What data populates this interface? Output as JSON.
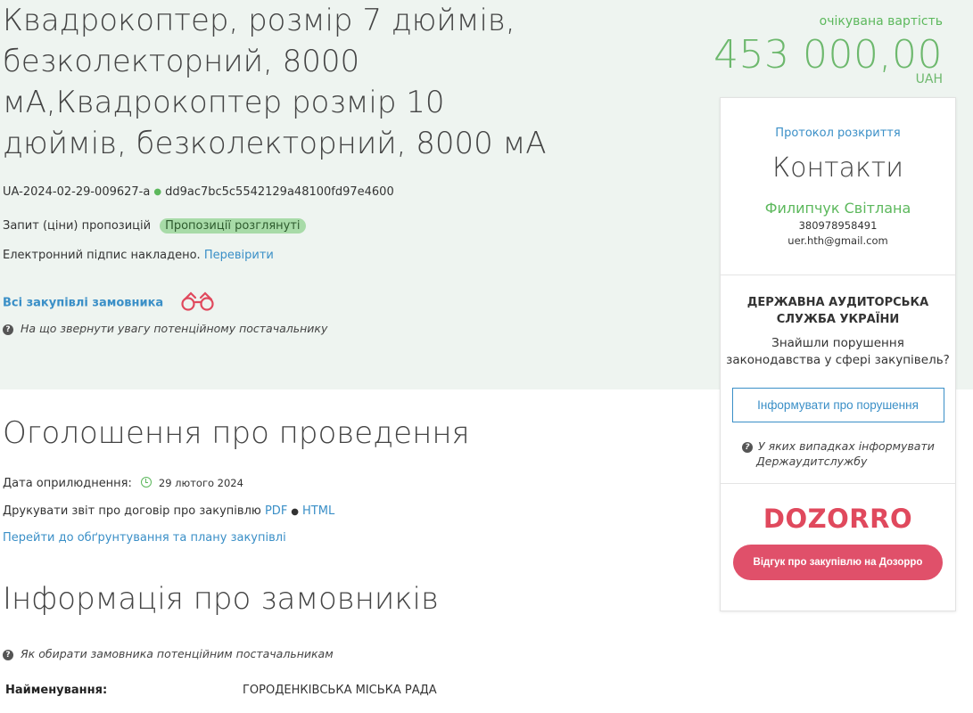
{
  "tender": {
    "title": "Квадрокоптер, розмір 7 дюймів, безколекторний, 8000 мА,Квадрокоптер розмір 10 дюймів, безколекторний, 8000 мА",
    "id": "UA-2024-02-29-009627-a",
    "hash": "dd9ac7bc5c5542129a48100fd97e4600",
    "procedure_type": "Запит (ціни) пропозицій",
    "status_badge": "Пропозиції розглянуті",
    "signature_text": "Електронний підпис накладено.",
    "signature_link": "Перевірити",
    "all_purchases_link": "Всі закупівлі замовника",
    "supplier_note": "На що звернути увагу потенційному постачальнику"
  },
  "price": {
    "label": "очікувана вартість",
    "value": "453 000,00",
    "currency": "UAH"
  },
  "sidebar": {
    "protocol_link": "Протокол розкриття",
    "contacts_heading": "Контакти",
    "contact_name": "Филипчук Світлана",
    "contact_phone": "380978958491",
    "contact_email": "uer.hth@gmail.com",
    "das_title": "ДЕРЖАВНА АУДИТОРСЬКА СЛУЖБА УКРАЇНИ",
    "das_text": "Знайшли порушення законодавства у сфері закупівель?",
    "das_button": "Інформувати про порушення",
    "das_note_line1": "У яких випадках інформувати",
    "das_note_line2": "Держаудитслужбу",
    "dozorro_logo": "DOZORRO",
    "dozorro_button": "Відгук про закупівлю на Дозорро"
  },
  "announcement": {
    "heading": "Оголошення про проведення",
    "date_label": "Дата оприлюднення:",
    "date_value": "29 лютого 2024",
    "print_text": "Друкувати звіт про договір про закупівлю",
    "print_pdf": "PDF",
    "print_html": "HTML",
    "plan_link": "Перейти до обґрунтування та плану закупівлі"
  },
  "customers": {
    "heading": "Інформація про замовників",
    "note": "Як обирати замовника потенційним постачальникам",
    "name_label": "Найменування:",
    "name_value": "ГОРОДЕНКІВСЬКА МІСЬКА РАДА"
  },
  "colors": {
    "accent_green": "#5cb85c",
    "link_blue": "#3a8fc7",
    "dozorro_red": "#e0495d",
    "band_bg": "#eef4f0"
  }
}
